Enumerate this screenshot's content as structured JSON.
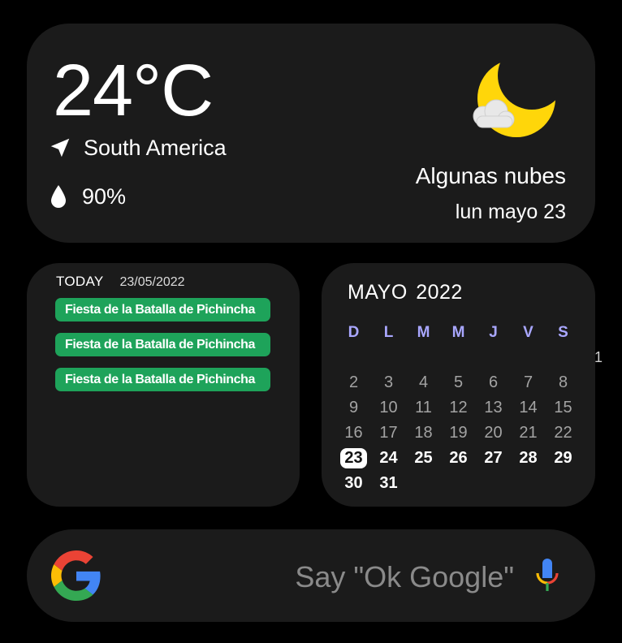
{
  "weather": {
    "temperature": "24°C",
    "location": "South America",
    "humidity": "90%",
    "condition": "Algunas nubes",
    "date": "lun mayo 23",
    "icon": "moon-with-cloud-icon"
  },
  "today_widget": {
    "label": "TODAY",
    "date": "23/05/2022",
    "events": [
      {
        "title": "Fiesta de la Batalla de Pichincha"
      },
      {
        "title": "Fiesta de la Batalla de Pichincha"
      },
      {
        "title": "Fiesta de la Batalla de Pichincha"
      }
    ],
    "event_color": "#1ea35a"
  },
  "calendar": {
    "title": "MAYO 2022",
    "weekdays": [
      "D",
      "L",
      "M",
      "M",
      "J",
      "V",
      "S"
    ],
    "weeks": [
      [
        "",
        "",
        "",
        "",
        "",
        "",
        ""
      ],
      [
        "2",
        "3",
        "4",
        "5",
        "6",
        "7",
        "8"
      ],
      [
        "9",
        "10",
        "11",
        "12",
        "13",
        "14",
        "15"
      ],
      [
        "16",
        "17",
        "18",
        "19",
        "20",
        "21",
        "22"
      ],
      [
        "23",
        "24",
        "25",
        "26",
        "27",
        "28",
        "29"
      ],
      [
        "30",
        "31",
        "",
        "",
        "",
        "",
        ""
      ]
    ],
    "stray_day": "1",
    "today": "23",
    "weekday_color": "#a9a7ff"
  },
  "search": {
    "hint": "Say \"Ok Google\"",
    "logo_icon": "google-g-icon",
    "mic_icon": "microphone-icon"
  }
}
